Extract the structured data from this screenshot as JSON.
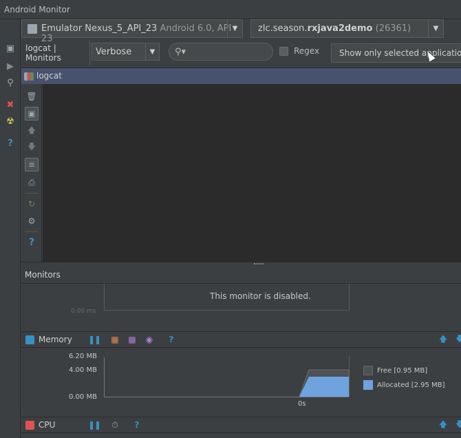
{
  "window": {
    "title": "Android Monitor"
  },
  "device": {
    "name": "Emulator Nexus_5_API_23",
    "detail": "Android 6.0, API 23"
  },
  "process": {
    "prefix": "zlc.season.",
    "name_bold": "rxjava2demo",
    "pid": "(26361)"
  },
  "tabs": {
    "label": "logcat | Monitors"
  },
  "log_level": {
    "value": "Verbose"
  },
  "search": {
    "value": "",
    "placeholder": ""
  },
  "regex": {
    "label": "Regex",
    "checked": false
  },
  "filter": {
    "label": "Show only selected application"
  },
  "logcat_panel": {
    "title": "logcat"
  },
  "monitors": {
    "header": "Monitors",
    "disabled_monitor": {
      "axis_value": "0.00 ms",
      "message": "This monitor is disabled."
    },
    "memory": {
      "label": "Memory",
      "icon_color": "#3592c4",
      "y_ticks": [
        "6.20 MB",
        "4.00 MB",
        "0.00 MB"
      ],
      "x_tick": "0s",
      "legend": [
        {
          "label": "Free [0.95 MB]",
          "color": "#4e5254"
        },
        {
          "label": "Allocated [2.95 MB]",
          "color": "#6fa3e0"
        }
      ]
    },
    "cpu": {
      "label": "CPU",
      "icon_color": "#e05252"
    }
  }
}
